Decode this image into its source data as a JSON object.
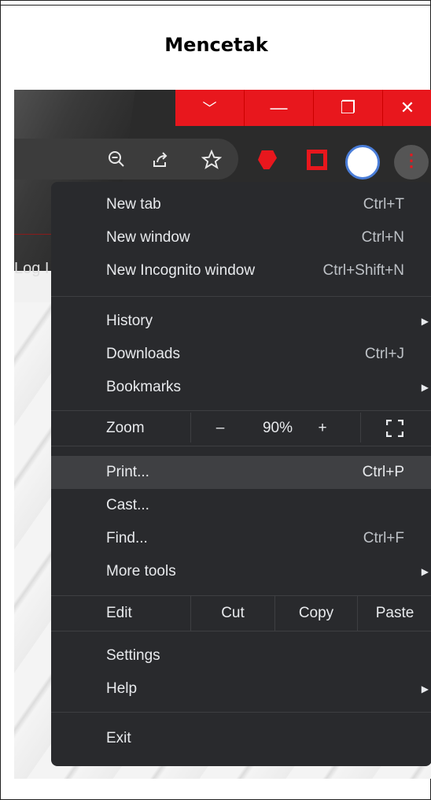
{
  "page": {
    "title": "Mencetak"
  },
  "window_controls": [
    "﹀",
    "—",
    "❐",
    "✕"
  ],
  "toolbar": {
    "icons": [
      "zoom-out-icon",
      "share-icon",
      "star-icon",
      "puzzle-extension-icon",
      "red-extension-icon",
      "profile-avatar",
      "menu-dots-icon"
    ],
    "page_link": "Log I"
  },
  "menu": {
    "new_tab": {
      "label": "New tab",
      "shortcut": "Ctrl+T"
    },
    "new_window": {
      "label": "New window",
      "shortcut": "Ctrl+N"
    },
    "new_incognito": {
      "label": "New Incognito window",
      "shortcut": "Ctrl+Shift+N"
    },
    "history": {
      "label": "History"
    },
    "downloads": {
      "label": "Downloads",
      "shortcut": "Ctrl+J"
    },
    "bookmarks": {
      "label": "Bookmarks"
    },
    "zoom": {
      "label": "Zoom",
      "minus": "–",
      "value": "90%",
      "plus": "+"
    },
    "print": {
      "label": "Print...",
      "shortcut": "Ctrl+P"
    },
    "cast": {
      "label": "Cast..."
    },
    "find": {
      "label": "Find...",
      "shortcut": "Ctrl+F"
    },
    "more_tools": {
      "label": "More tools"
    },
    "edit": {
      "label": "Edit",
      "cut": "Cut",
      "copy": "Copy",
      "paste": "Paste"
    },
    "settings": {
      "label": "Settings"
    },
    "help": {
      "label": "Help"
    },
    "exit": {
      "label": "Exit"
    }
  },
  "colors": {
    "accent": "#e8171d",
    "menu_bg": "#292a2d",
    "highlight": "#3f4043"
  }
}
